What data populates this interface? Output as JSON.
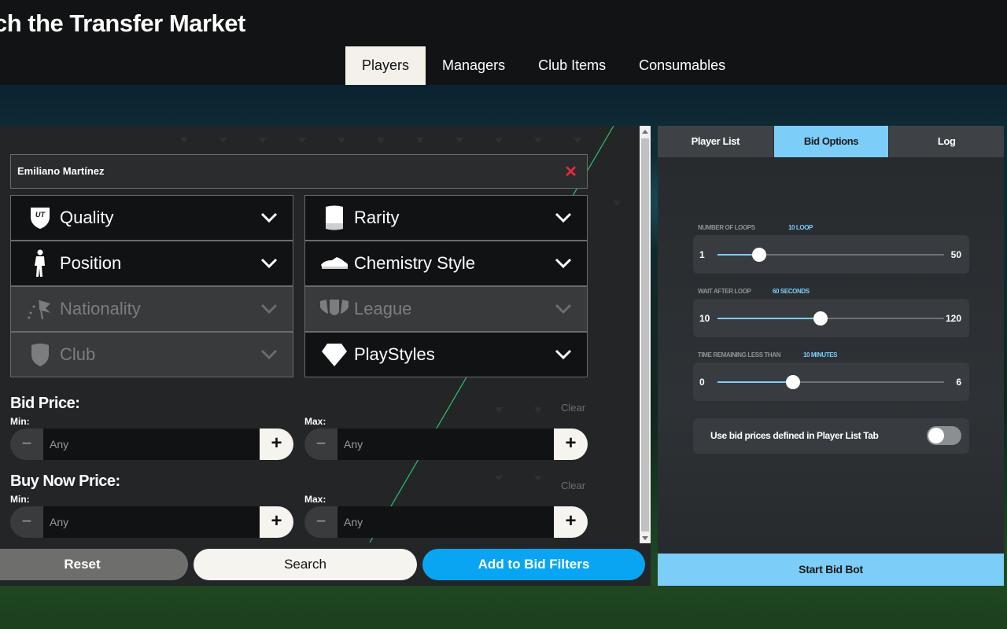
{
  "header": {
    "title": "ch the Transfer Market",
    "tabs": [
      {
        "label": "Players",
        "active": true
      },
      {
        "label": "Managers",
        "active": false
      },
      {
        "label": "Club Items",
        "active": false
      },
      {
        "label": "Consumables",
        "active": false
      }
    ]
  },
  "search": {
    "player_name": "Emiliano Martínez",
    "clear_icon": "close-icon"
  },
  "filters": {
    "quality": {
      "label": "Quality",
      "icon": "quality-badge-icon",
      "enabled": true
    },
    "rarity": {
      "label": "Rarity",
      "icon": "rarity-card-icon",
      "enabled": true
    },
    "position": {
      "label": "Position",
      "icon": "player-figure-icon",
      "enabled": true
    },
    "chemistry_style": {
      "label": "Chemistry Style",
      "icon": "boot-icon",
      "enabled": true
    },
    "nationality": {
      "label": "Nationality",
      "icon": "flag-icon",
      "enabled": false
    },
    "league": {
      "label": "League",
      "icon": "league-shield-icon",
      "enabled": false
    },
    "club": {
      "label": "Club",
      "icon": "club-crest-icon",
      "enabled": false
    },
    "playstyles": {
      "label": "PlayStyles",
      "icon": "diamond-icon",
      "enabled": true
    }
  },
  "bid_price": {
    "title": "Bid Price:",
    "clear": "Clear",
    "min_label": "Min:",
    "max_label": "Max:",
    "min_placeholder": "Any",
    "max_placeholder": "Any"
  },
  "buy_now_price": {
    "title": "Buy Now Price:",
    "clear": "Clear",
    "min_label": "Min:",
    "max_label": "Max:",
    "min_placeholder": "Any",
    "max_placeholder": "Any"
  },
  "actions": {
    "reset": "Reset",
    "search": "Search",
    "add_to_bid_filters": "Add to Bid Filters"
  },
  "bot_panel": {
    "tabs": [
      {
        "label": "Player List",
        "active": false
      },
      {
        "label": "Bid Options",
        "active": true
      },
      {
        "label": "Log",
        "active": false
      }
    ],
    "sliders": [
      {
        "label": "Number of loops",
        "value_text": "10 loop",
        "min": "1",
        "max": "50",
        "value": 10
      },
      {
        "label": "Wait after loop",
        "value_text": "60 seconds",
        "min": "10",
        "max": "120",
        "value": 60
      },
      {
        "label": "Time remaining less than",
        "value_text": "10 minutes",
        "min": "0",
        "max": "6",
        "value": 2
      }
    ],
    "toggle": {
      "label": "Use bid prices defined in Player List Tab",
      "on": false
    },
    "start_button": "Start Bid Bot"
  },
  "colors": {
    "accent_blue": "#0aa5f2",
    "light_blue": "#7ccdf7",
    "clear_red": "#e12b3c",
    "panel_bg": "#232527",
    "header_bg": "#121314"
  }
}
